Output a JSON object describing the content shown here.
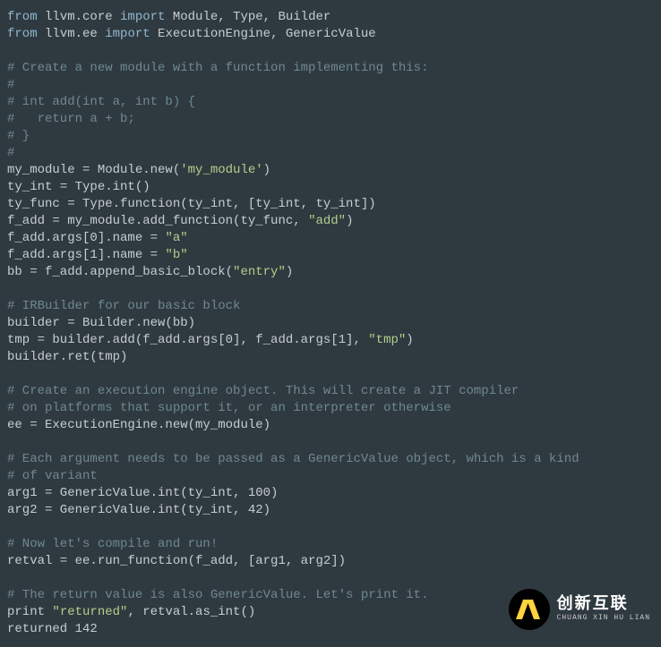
{
  "lines": [
    [
      [
        "kw",
        "from"
      ],
      [
        "id",
        " llvm.core "
      ],
      [
        "kw",
        "import"
      ],
      [
        "id",
        " Module, Type, Builder"
      ]
    ],
    [
      [
        "kw",
        "from"
      ],
      [
        "id",
        " llvm.ee "
      ],
      [
        "kw",
        "import"
      ],
      [
        "id",
        " ExecutionEngine, GenericValue"
      ]
    ],
    [],
    [
      [
        "cmt",
        "# Create a new module with a function implementing this:"
      ]
    ],
    [
      [
        "cmt",
        "#"
      ]
    ],
    [
      [
        "cmt",
        "# int add(int a, int b) {"
      ]
    ],
    [
      [
        "cmt",
        "#   return a + b;"
      ]
    ],
    [
      [
        "cmt",
        "# }"
      ]
    ],
    [
      [
        "cmt",
        "#"
      ]
    ],
    [
      [
        "id",
        "my_module = Module.new("
      ],
      [
        "str",
        "'my_module'"
      ],
      [
        "id",
        ")"
      ]
    ],
    [
      [
        "id",
        "ty_int = Type.int()"
      ]
    ],
    [
      [
        "id",
        "ty_func = Type.function(ty_int, [ty_int, ty_int])"
      ]
    ],
    [
      [
        "id",
        "f_add = my_module.add_function(ty_func, "
      ],
      [
        "str",
        "\"add\""
      ],
      [
        "id",
        ")"
      ]
    ],
    [
      [
        "id",
        "f_add.args[0].name = "
      ],
      [
        "str",
        "\"a\""
      ]
    ],
    [
      [
        "id",
        "f_add.args[1].name = "
      ],
      [
        "str",
        "\"b\""
      ]
    ],
    [
      [
        "id",
        "bb = f_add.append_basic_block("
      ],
      [
        "str",
        "\"entry\""
      ],
      [
        "id",
        ")"
      ]
    ],
    [],
    [
      [
        "cmt",
        "# IRBuilder for our basic block"
      ]
    ],
    [
      [
        "id",
        "builder = Builder.new(bb)"
      ]
    ],
    [
      [
        "id",
        "tmp = builder.add(f_add.args[0], f_add.args[1], "
      ],
      [
        "str",
        "\"tmp\""
      ],
      [
        "id",
        ")"
      ]
    ],
    [
      [
        "id",
        "builder.ret(tmp)"
      ]
    ],
    [],
    [
      [
        "cmt",
        "# Create an execution engine object. This will create a JIT compiler"
      ]
    ],
    [
      [
        "cmt",
        "# on platforms that support it, or an interpreter otherwise"
      ]
    ],
    [
      [
        "id",
        "ee = ExecutionEngine.new(my_module)"
      ]
    ],
    [],
    [
      [
        "cmt",
        "# Each argument needs to be passed as a GenericValue object, which is a kind"
      ]
    ],
    [
      [
        "cmt",
        "# of variant"
      ]
    ],
    [
      [
        "id",
        "arg1 = GenericValue.int(ty_int, 100)"
      ]
    ],
    [
      [
        "id",
        "arg2 = GenericValue.int(ty_int, 42)"
      ]
    ],
    [],
    [
      [
        "cmt",
        "# Now let's compile and run!"
      ]
    ],
    [
      [
        "id",
        "retval = ee.run_function(f_add, [arg1, arg2])"
      ]
    ],
    [],
    [
      [
        "cmt",
        "# The return value is also GenericValue. Let's print it."
      ]
    ],
    [
      [
        "pkw",
        "print "
      ],
      [
        "str",
        "\"returned\""
      ],
      [
        "id",
        ", retval.as_int()"
      ]
    ],
    [
      [
        "id",
        "returned 142"
      ]
    ]
  ],
  "logo": {
    "cn": "创新互联",
    "en": "CHUANG XIN HU LIAN"
  }
}
